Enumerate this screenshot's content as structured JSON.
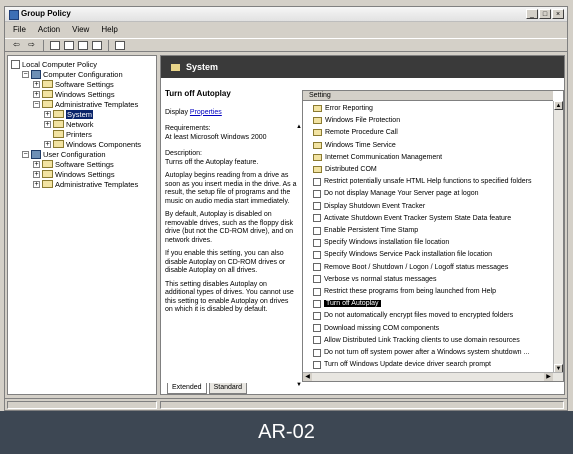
{
  "window": {
    "title": "Group Policy"
  },
  "menu": [
    "File",
    "Action",
    "View",
    "Help"
  ],
  "toolbar": {
    "back": "⇦",
    "forward": "⇨"
  },
  "tree": [
    {
      "label": "Local Computer Policy",
      "indent": 0,
      "pm": "",
      "icon": "policy"
    },
    {
      "label": "Computer Configuration",
      "indent": 1,
      "pm": "−",
      "icon": "computer"
    },
    {
      "label": "Software Settings",
      "indent": 2,
      "pm": "+",
      "icon": "folder"
    },
    {
      "label": "Windows Settings",
      "indent": 2,
      "pm": "+",
      "icon": "folder"
    },
    {
      "label": "Administrative Templates",
      "indent": 2,
      "pm": "−",
      "icon": "folder"
    },
    {
      "label": "System",
      "indent": 3,
      "pm": "+",
      "icon": "folder",
      "selected": true
    },
    {
      "label": "Network",
      "indent": 3,
      "pm": "+",
      "icon": "folder"
    },
    {
      "label": "Printers",
      "indent": 3,
      "pm": "",
      "icon": "folder"
    },
    {
      "label": "Windows Components",
      "indent": 3,
      "pm": "+",
      "icon": "folder"
    },
    {
      "label": "User Configuration",
      "indent": 1,
      "pm": "−",
      "icon": "computer"
    },
    {
      "label": "Software Settings",
      "indent": 2,
      "pm": "+",
      "icon": "folder"
    },
    {
      "label": "Windows Settings",
      "indent": 2,
      "pm": "+",
      "icon": "folder"
    },
    {
      "label": "Administrative Templates",
      "indent": 2,
      "pm": "+",
      "icon": "folder"
    }
  ],
  "header": {
    "title": "System"
  },
  "description": {
    "title": "Turn off Autoplay",
    "display_prefix": "Display ",
    "display_link": "Properties",
    "requirements_label": "Requirements:",
    "requirements_value": "At least Microsoft Windows 2000",
    "description_label": "Description:",
    "description_value": "Turns off the Autoplay feature.",
    "p1": "Autoplay begins reading from a drive as soon as you insert media in the drive. As a result, the setup file of programs and the music on audio media start immediately.",
    "p2": "By default, Autoplay is disabled on removable drives, such as the floppy disk drive (but not the CD-ROM drive), and on network drives.",
    "p3": "If you enable this setting, you can also disable Autoplay on CD-ROM drives or disable Autoplay on all drives.",
    "p4": "This setting disables Autoplay on additional types of drives. You cannot use this setting to enable Autoplay on drives on which it is disabled by default."
  },
  "list": {
    "column": "Setting",
    "items": [
      {
        "label": "Error Reporting",
        "type": "folder"
      },
      {
        "label": "Windows File Protection",
        "type": "folder"
      },
      {
        "label": "Remote Procedure Call",
        "type": "folder"
      },
      {
        "label": "Windows Time Service",
        "type": "folder"
      },
      {
        "label": "Internet Communication Management",
        "type": "folder"
      },
      {
        "label": "Distributed COM",
        "type": "folder"
      },
      {
        "label": "Restrict potentially unsafe HTML Help functions to specified folders",
        "type": "setting"
      },
      {
        "label": "Do not display Manage Your Server page at logon",
        "type": "setting"
      },
      {
        "label": "Display Shutdown Event Tracker",
        "type": "setting"
      },
      {
        "label": "Activate Shutdown Event Tracker System State Data feature",
        "type": "setting"
      },
      {
        "label": "Enable Persistent Time Stamp",
        "type": "setting"
      },
      {
        "label": "Specify Windows installation file location",
        "type": "setting"
      },
      {
        "label": "Specify Windows Service Pack installation file location",
        "type": "setting"
      },
      {
        "label": "Remove Boot / Shutdown / Logon / Logoff status messages",
        "type": "setting"
      },
      {
        "label": "Verbose vs normal status messages",
        "type": "setting"
      },
      {
        "label": "Restrict these programs from being launched from Help",
        "type": "setting"
      },
      {
        "label": "Turn off Autoplay",
        "type": "setting",
        "selected": true
      },
      {
        "label": "Do not automatically encrypt files moved to encrypted folders",
        "type": "setting"
      },
      {
        "label": "Download missing COM components",
        "type": "setting"
      },
      {
        "label": "Allow Distributed Link Tracking clients to use domain resources",
        "type": "setting"
      },
      {
        "label": "Do not turn off system power after a Windows system shutdown ...",
        "type": "setting"
      },
      {
        "label": "Turn off Windows Update device driver search prompt",
        "type": "setting"
      }
    ]
  },
  "tabs": [
    "Extended",
    "Standard"
  ],
  "caption": "AR-02"
}
